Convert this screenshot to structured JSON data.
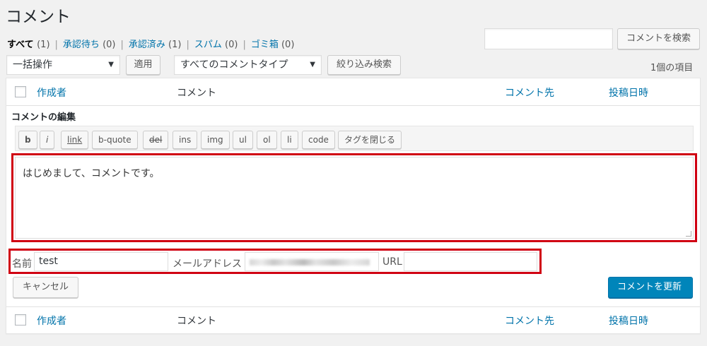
{
  "page": {
    "title": "コメント"
  },
  "filters": [
    {
      "label": "すべて",
      "count": "(1)",
      "current": true
    },
    {
      "label": "承認待ち",
      "count": "(0)"
    },
    {
      "label": "承認済み",
      "count": "(1)"
    },
    {
      "label": "スパム",
      "count": "(0)"
    },
    {
      "label": "ゴミ箱",
      "count": "(0)"
    }
  ],
  "search": {
    "value": "",
    "button": "コメントを検索"
  },
  "bulk": {
    "selected": "一括操作",
    "apply": "適用"
  },
  "type_filter": {
    "selected": "すべてのコメントタイプ",
    "button": "絞り込み検索"
  },
  "item_count": "1個の項目",
  "columns": {
    "author": "作成者",
    "comment": "コメント",
    "response": "コメント先",
    "date": "投稿日時"
  },
  "editor": {
    "heading": "コメントの編集",
    "quicktags": [
      "b",
      "i",
      "link",
      "b-quote",
      "del",
      "ins",
      "img",
      "ul",
      "ol",
      "li",
      "code",
      "タグを閉じる"
    ],
    "content": "はじめまして、コメントです。",
    "name_label": "名前",
    "name_value": "test",
    "email_label": "メールアドレス",
    "url_label": "URL",
    "url_value": "",
    "cancel": "キャンセル",
    "update": "コメントを更新"
  },
  "colors": {
    "link": "#0073aa",
    "primary": "#0085ba",
    "highlight": "#d00012"
  }
}
